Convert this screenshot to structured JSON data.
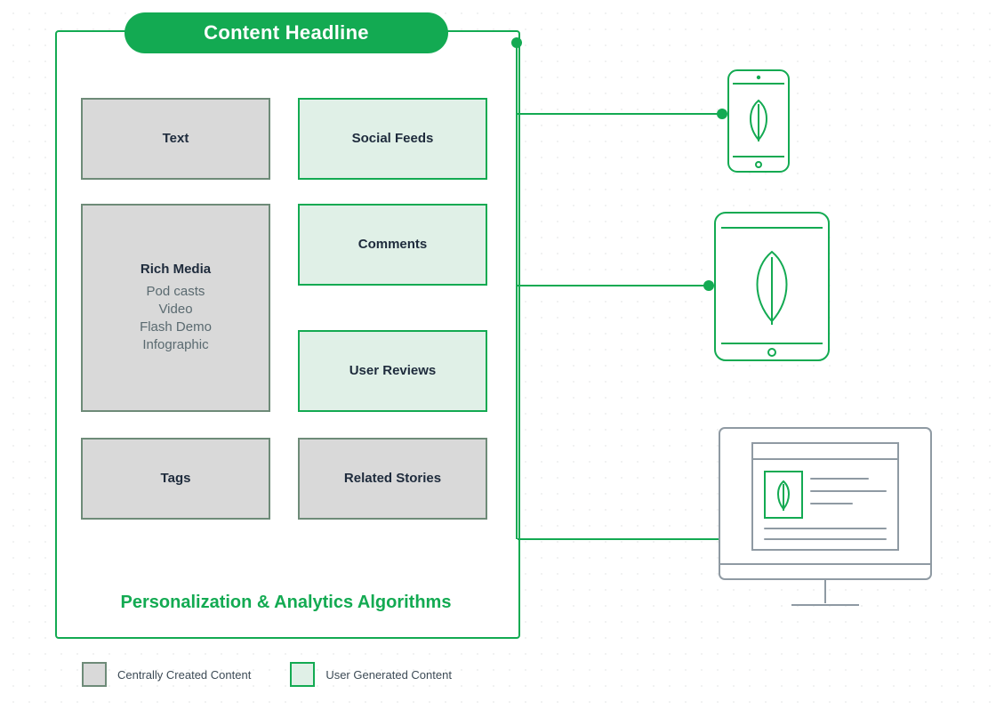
{
  "headline": "Content Headline",
  "panel_footer": "Personalization & Analytics Algorithms",
  "boxes": {
    "text": {
      "title": "Text"
    },
    "social": {
      "title": "Social Feeds"
    },
    "rich": {
      "title": "Rich Media",
      "sub": "Pod casts\nVideo\nFlash Demo\nInfographic"
    },
    "comments": {
      "title": "Comments"
    },
    "reviews": {
      "title": "User Reviews"
    },
    "tags": {
      "title": "Tags"
    },
    "related": {
      "title": "Related Stories"
    }
  },
  "legend": {
    "central": "Centrally Created Content",
    "ugc": "User Generated Content"
  },
  "colors": {
    "green": "#13AA52",
    "pale_green": "#e0f0e7",
    "grey": "#d9d9d9"
  },
  "devices": [
    "phone",
    "tablet",
    "desktop"
  ]
}
